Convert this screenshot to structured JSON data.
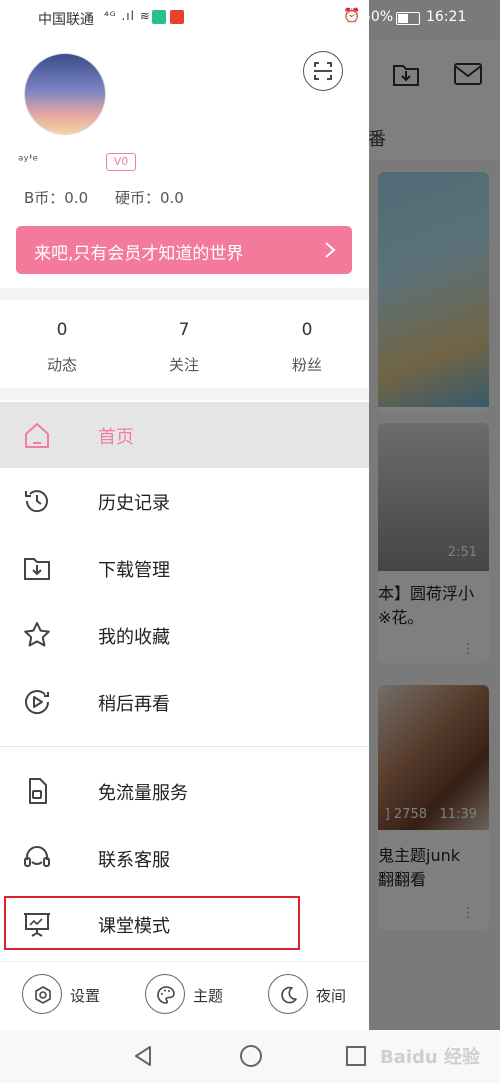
{
  "status": {
    "carrier": "中国联通",
    "network_icons": "⁴ᴳ .ıl ≋",
    "battery_text": "50%",
    "time": "16:21"
  },
  "profile": {
    "username": "ᵃʸ'ᵉ",
    "level": "V0",
    "b_coin": "B币：0.0",
    "hard_coin": "硬币：0.0"
  },
  "vip_banner": {
    "text": "来吧,只有会员才知道的世界"
  },
  "stats": [
    {
      "value": "0",
      "label": "动态"
    },
    {
      "value": "7",
      "label": "关注"
    },
    {
      "value": "0",
      "label": "粉丝"
    }
  ],
  "menu": {
    "home": "首页",
    "history": "历史记录",
    "download": "下载管理",
    "favorites": "我的收藏",
    "watch_later": "稍后再看",
    "free_data": "免流量服务",
    "support": "联系客服",
    "classroom": "课堂模式"
  },
  "bottom": {
    "settings": "设置",
    "theme": "主题",
    "night": "夜间"
  },
  "background": {
    "tab_partial": "番",
    "card1_duration": "2:51",
    "card1_line1": "本】圆荷浮小",
    "card1_line2": "※花。",
    "card2_views": "] 2758",
    "card2_duration": "11:39",
    "card2_line1": "鬼主题junk",
    "card2_line2": "翻翻看"
  },
  "watermark": "Baidu 经验",
  "colors": {
    "accent": "#f07fa3",
    "banner": "#f47a9b",
    "highlight": "#d9232d"
  }
}
